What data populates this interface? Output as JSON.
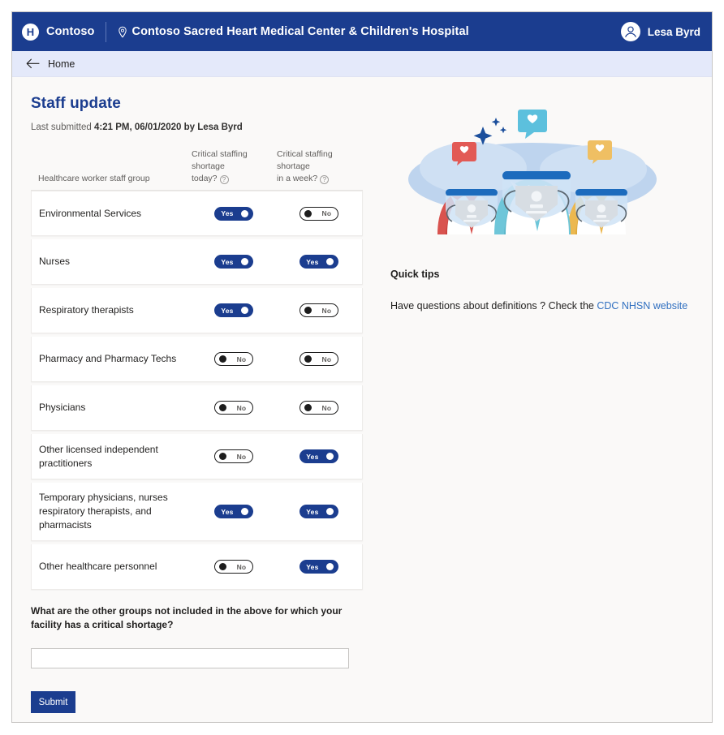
{
  "topbar": {
    "logo_letter": "H",
    "brand_name": "Contoso",
    "facility_name": "Contoso Sacred Heart Medical Center & Children's Hospital",
    "pin_icon": "location-pin-icon",
    "user_name": "Lesa Byrd",
    "avatar_icon": "person-icon",
    "background_color": "#1b3d8f"
  },
  "breadcrumb": {
    "back_icon": "arrow-left-icon",
    "label": "Home",
    "background_color": "#e4e9fa"
  },
  "page": {
    "title": "Staff update",
    "title_color": "#1b3d8f",
    "last_submitted_prefix": "Last submitted ",
    "last_submitted_value": "4:21 PM, 06/01/2020 by Lesa Byrd"
  },
  "table": {
    "headers": {
      "group": "Healthcare worker staff group",
      "today": "Critical staffing shortage today?",
      "today_line1": "Critical staffing shortage",
      "today_line2": "today?",
      "week": "Critical staffing shortage in a week?",
      "week_line1": "Critical staffing shortage",
      "week_line2": "in a week?",
      "help_icon": "question-circle-icon"
    },
    "yes_label": "Yes",
    "no_label": "No",
    "rows": [
      {
        "label": "Environmental Services",
        "has_help": false,
        "today": "Yes",
        "week": "No"
      },
      {
        "label": "Nurses",
        "has_help": true,
        "today": "Yes",
        "week": "Yes"
      },
      {
        "label": "Respiratory therapists",
        "has_help": false,
        "today": "Yes",
        "week": "No"
      },
      {
        "label": "Pharmacy and Pharmacy Techs",
        "has_help": false,
        "today": "No",
        "week": "No"
      },
      {
        "label": "Physicians",
        "has_help": true,
        "today": "No",
        "week": "No"
      },
      {
        "label": "Other licensed independent practitioners",
        "has_help": true,
        "today": "No",
        "week": "Yes"
      },
      {
        "label": "Temporary physicians, nurses respiratory therapists, and pharmacists",
        "has_help": true,
        "today": "Yes",
        "week": "Yes"
      },
      {
        "label": "Other healthcare personnel",
        "has_help": true,
        "today": "No",
        "week": "Yes"
      }
    ]
  },
  "other_groups": {
    "question": "What are the other groups not included in the above for which your facility has a critical shortage?",
    "value": "",
    "placeholder": ""
  },
  "submit": {
    "label": "Submit",
    "color": "#1b3d8f"
  },
  "aside": {
    "illustration_name": "three-healthcare-workers-with-masks-illustration",
    "tips_title": "Quick tips",
    "tips_text_before": "Have questions about definitions ? Check the ",
    "tips_link_text": "CDC NHSN website",
    "link_color": "#2f6fc0"
  }
}
